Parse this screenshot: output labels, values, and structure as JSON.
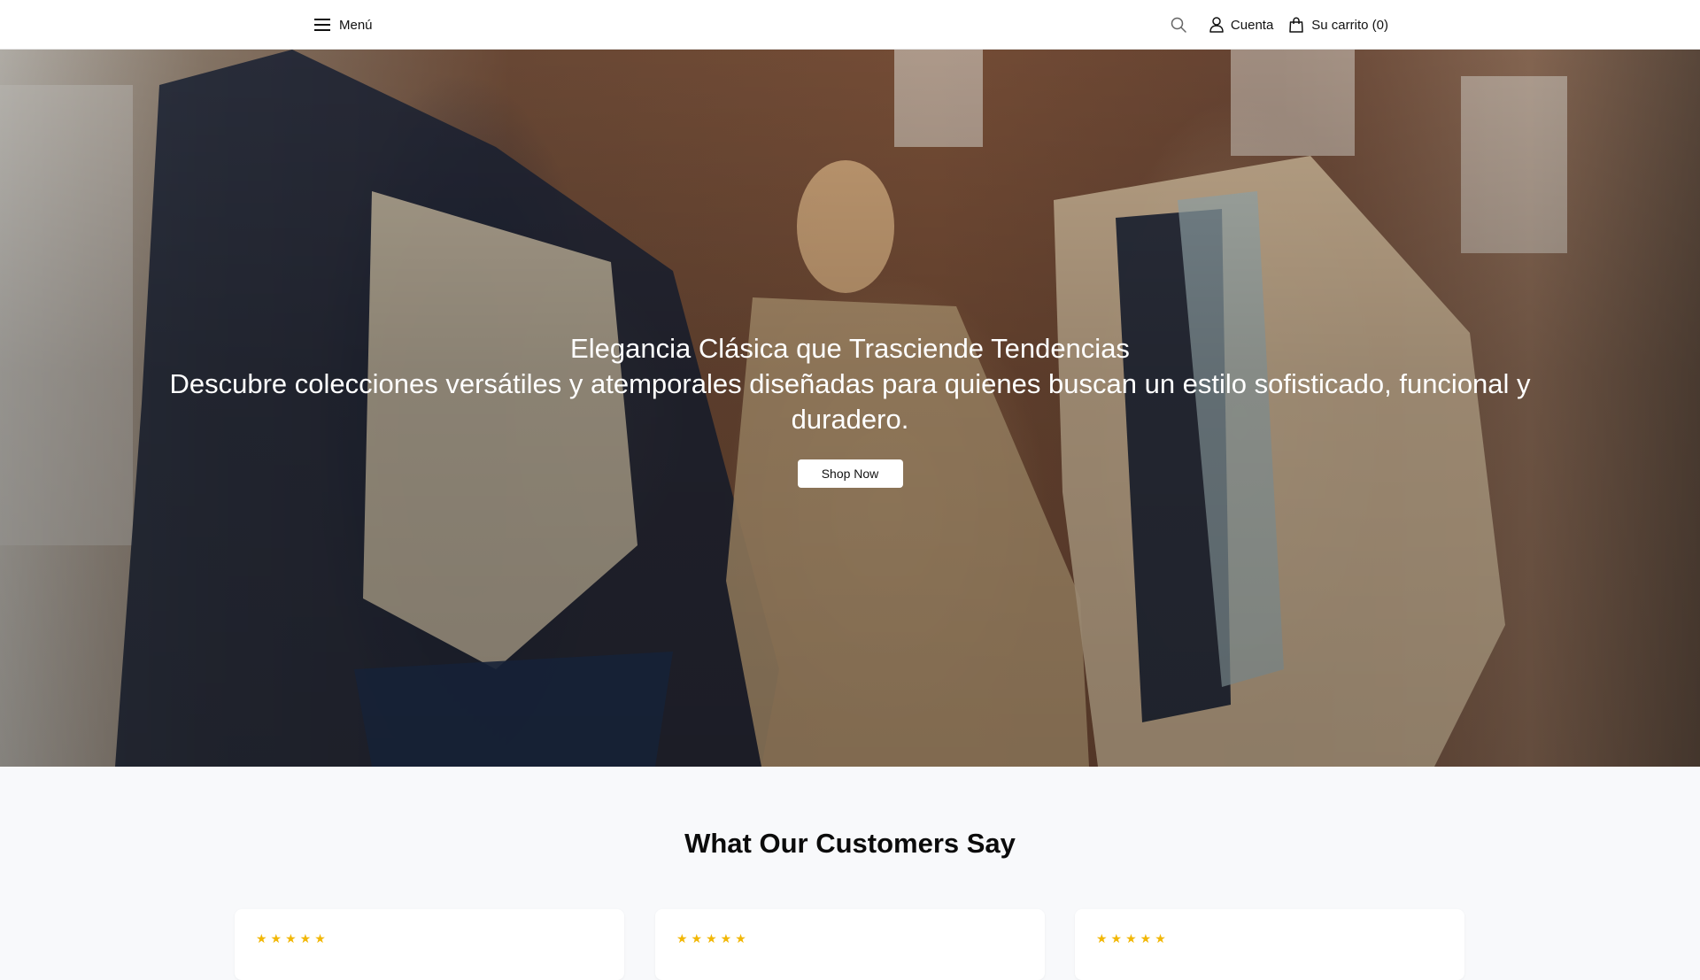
{
  "header": {
    "menu_label": "Menú",
    "account_label": "Cuenta",
    "cart_label": "Su carrito (0)",
    "icons": {
      "menu": "hamburger-icon",
      "search": "search-icon",
      "account": "user-icon",
      "cart": "shopping-bag-icon"
    }
  },
  "hero": {
    "title": "Elegancia Clásica que Trasciende Tendencias",
    "subtitle": "Descubre colecciones versátiles y atemporales diseñadas para quienes buscan un estilo sofisticado, funcional y duradero.",
    "cta_label": "Shop Now"
  },
  "testimonials": {
    "title": "What Our Customers Say",
    "cards": [
      {
        "stars": "★★★★★"
      },
      {
        "stars": "★★★★★"
      },
      {
        "stars": "★★★★★"
      }
    ]
  },
  "colors": {
    "header_bg": "#ffffff",
    "page_bg": "#f8f9fb",
    "star": "#f2b705",
    "button_bg": "#ffffff"
  }
}
